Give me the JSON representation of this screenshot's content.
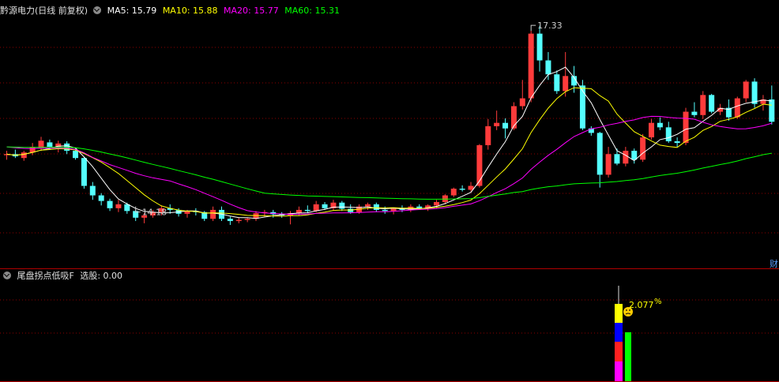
{
  "main_header": {
    "stock_name": "黔源电力",
    "period": "(日线 前复权)",
    "ma5_label": "MA5: 15.79",
    "ma10_label": "MA10: 15.88",
    "ma20_label": "MA20: 15.77",
    "ma60_label": "MA60: 15.31"
  },
  "sub_header": {
    "indicator_name": "尾盘拐点低吸F",
    "value_label": "选股: 0.00"
  },
  "colors": {
    "up": "#ff3b3b",
    "down": "#54ffff",
    "ma5": "#ffffff",
    "ma10": "#ffff00",
    "ma20": "#ff00ff",
    "ma60": "#00ff00",
    "grid": "#8b0000"
  },
  "right_edge_label": "财",
  "chart_data": [
    {
      "type": "candlestick",
      "price_range": [
        13.1,
        17.6
      ],
      "annotations": [
        {
          "label": "17.33",
          "bar_index": 61,
          "value": 17.33
        },
        {
          "label": "14.18",
          "bar_index": 15,
          "value": 14.18
        }
      ],
      "ohlc": [
        [
          15.1,
          15.18,
          15.02,
          15.12
        ],
        [
          15.12,
          15.2,
          15.05,
          15.08
        ],
        [
          15.05,
          15.18,
          15.0,
          15.15
        ],
        [
          15.15,
          15.32,
          15.1,
          15.25
        ],
        [
          15.22,
          15.43,
          15.18,
          15.36
        ],
        [
          15.33,
          15.38,
          15.2,
          15.25
        ],
        [
          15.25,
          15.36,
          15.15,
          15.31
        ],
        [
          15.31,
          15.35,
          15.12,
          15.18
        ],
        [
          15.18,
          15.22,
          15.02,
          15.05
        ],
        [
          15.05,
          15.06,
          14.5,
          14.55
        ],
        [
          14.55,
          14.62,
          14.3,
          14.38
        ],
        [
          14.38,
          14.42,
          14.2,
          14.28
        ],
        [
          14.28,
          14.32,
          14.1,
          14.15
        ],
        [
          14.15,
          14.3,
          14.08,
          14.22
        ],
        [
          14.22,
          14.25,
          14.05,
          14.1
        ],
        [
          14.1,
          14.12,
          13.92,
          13.98
        ],
        [
          13.98,
          14.06,
          13.88,
          14.02
        ],
        [
          14.02,
          14.12,
          13.98,
          14.08
        ],
        [
          14.08,
          14.2,
          14.02,
          14.15
        ],
        [
          14.15,
          14.22,
          14.05,
          14.12
        ],
        [
          14.12,
          14.15,
          14.0,
          14.05
        ],
        [
          14.05,
          14.12,
          13.98,
          14.1
        ],
        [
          14.1,
          14.15,
          14.02,
          14.08
        ],
        [
          14.08,
          14.1,
          13.92,
          13.96
        ],
        [
          13.96,
          14.18,
          13.92,
          14.12
        ],
        [
          14.12,
          14.18,
          13.92,
          13.96
        ],
        [
          13.96,
          14.0,
          13.85,
          13.92
        ],
        [
          13.92,
          13.98,
          13.88,
          13.94
        ],
        [
          13.94,
          13.98,
          13.9,
          13.96
        ],
        [
          13.96,
          14.1,
          13.92,
          14.06
        ],
        [
          14.06,
          14.12,
          14.0,
          14.08
        ],
        [
          14.08,
          14.12,
          13.98,
          14.04
        ],
        [
          14.04,
          14.08,
          13.98,
          14.02
        ],
        [
          14.02,
          14.1,
          13.86,
          14.06
        ],
        [
          14.06,
          14.18,
          14.02,
          14.12
        ],
        [
          14.12,
          14.2,
          14.06,
          14.1
        ],
        [
          14.1,
          14.28,
          14.08,
          14.22
        ],
        [
          14.22,
          14.26,
          14.12,
          14.15
        ],
        [
          14.15,
          14.3,
          14.1,
          14.25
        ],
        [
          14.25,
          14.28,
          14.1,
          14.14
        ],
        [
          14.14,
          14.22,
          14.05,
          14.08
        ],
        [
          14.08,
          14.22,
          14.05,
          14.18
        ],
        [
          14.18,
          14.25,
          14.12,
          14.22
        ],
        [
          14.22,
          14.25,
          14.08,
          14.12
        ],
        [
          14.12,
          14.18,
          14.05,
          14.1
        ],
        [
          14.1,
          14.16,
          14.04,
          14.14
        ],
        [
          14.14,
          14.2,
          14.08,
          14.12
        ],
        [
          14.12,
          14.22,
          14.08,
          14.18
        ],
        [
          14.18,
          14.22,
          14.12,
          14.15
        ],
        [
          14.15,
          14.22,
          14.1,
          14.2
        ],
        [
          14.2,
          14.3,
          14.15,
          14.26
        ],
        [
          14.26,
          14.4,
          14.22,
          14.38
        ],
        [
          14.38,
          14.52,
          14.35,
          14.5
        ],
        [
          14.5,
          14.56,
          14.45,
          14.48
        ],
        [
          14.48,
          14.62,
          14.45,
          14.55
        ],
        [
          14.55,
          15.3,
          14.52,
          15.28
        ],
        [
          15.28,
          15.75,
          15.2,
          15.62
        ],
        [
          15.62,
          15.9,
          15.55,
          15.68
        ],
        [
          15.68,
          15.76,
          15.4,
          15.58
        ],
        [
          15.58,
          16.05,
          15.55,
          15.98
        ],
        [
          15.98,
          16.45,
          15.92,
          16.12
        ],
        [
          16.12,
          17.33,
          16.05,
          17.28
        ],
        [
          17.28,
          17.42,
          16.6,
          16.8
        ],
        [
          16.8,
          16.95,
          16.45,
          16.55
        ],
        [
          16.55,
          16.62,
          16.2,
          16.25
        ],
        [
          16.25,
          16.95,
          16.15,
          16.52
        ],
        [
          16.52,
          16.7,
          16.22,
          16.35
        ],
        [
          16.35,
          16.45,
          15.55,
          15.58
        ],
        [
          15.58,
          15.62,
          15.45,
          15.5
        ],
        [
          15.5,
          15.52,
          14.52,
          14.75
        ],
        [
          14.75,
          15.25,
          14.7,
          15.12
        ],
        [
          15.12,
          15.22,
          14.92,
          14.95
        ],
        [
          14.95,
          15.25,
          14.9,
          15.18
        ],
        [
          15.18,
          15.22,
          14.95,
          15.02
        ],
        [
          15.02,
          15.48,
          14.98,
          15.42
        ],
        [
          15.42,
          15.75,
          15.38,
          15.68
        ],
        [
          15.68,
          15.78,
          15.55,
          15.6
        ],
        [
          15.6,
          15.7,
          15.32,
          15.35
        ],
        [
          15.35,
          15.42,
          15.25,
          15.32
        ],
        [
          15.32,
          15.95,
          15.28,
          15.88
        ],
        [
          15.88,
          16.05,
          15.78,
          15.82
        ],
        [
          15.82,
          16.25,
          15.75,
          16.18
        ],
        [
          16.18,
          16.2,
          15.85,
          15.88
        ],
        [
          15.88,
          16.02,
          15.82,
          15.95
        ],
        [
          15.95,
          16.1,
          15.72,
          15.78
        ],
        [
          15.78,
          16.15,
          15.75,
          16.12
        ],
        [
          16.12,
          16.45,
          16.05,
          16.42
        ],
        [
          16.42,
          16.48,
          15.95,
          16.02
        ],
        [
          16.02,
          16.18,
          15.9,
          16.1
        ],
        [
          16.1,
          16.35,
          15.65,
          15.7
        ]
      ]
    },
    {
      "type": "bar",
      "indicator": "尾盘拐点低吸F",
      "value_label": "2.077",
      "unit": "%"
    }
  ]
}
